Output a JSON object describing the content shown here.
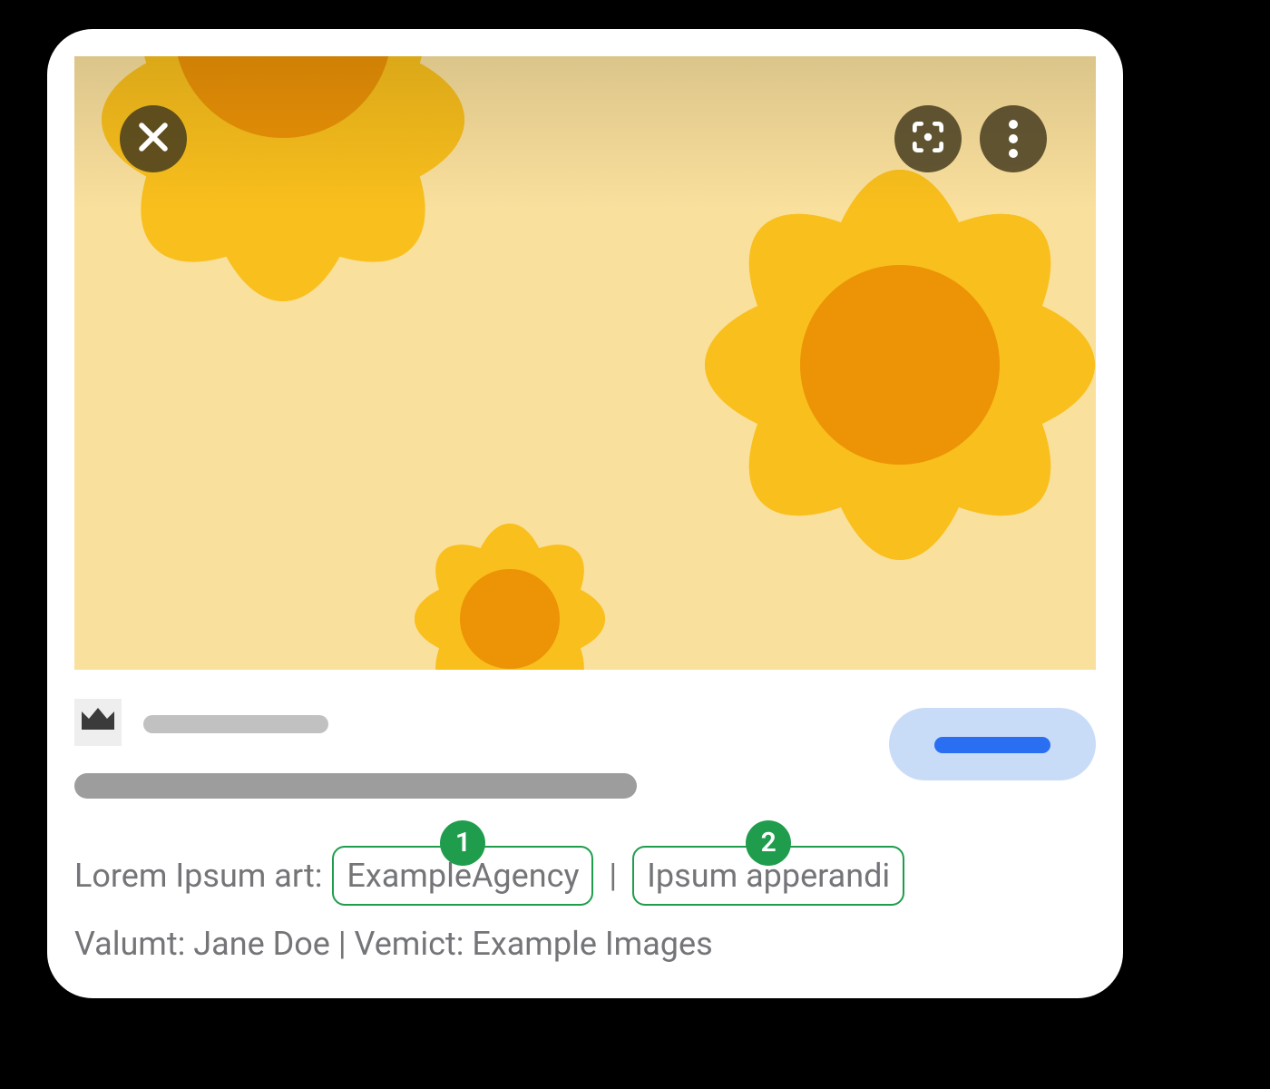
{
  "icons": {
    "close": "close-icon",
    "lens": "lens-icon",
    "more": "more-vertical-icon",
    "crown": "crown-icon"
  },
  "credits": {
    "line1": {
      "prefix": "Lorem Ipsum art: ",
      "highlight1": {
        "number": "1",
        "text": "ExampleAgency"
      },
      "separator": " | ",
      "highlight2": {
        "number": "2",
        "text": "Ipsum apperandi"
      }
    },
    "line2": {
      "part1_label": "Valumt:  ",
      "part1_value": "Jane Doe",
      "separator": "  |  ",
      "part2_label": "Vemict: ",
      "part2_value": "Example Images"
    }
  }
}
